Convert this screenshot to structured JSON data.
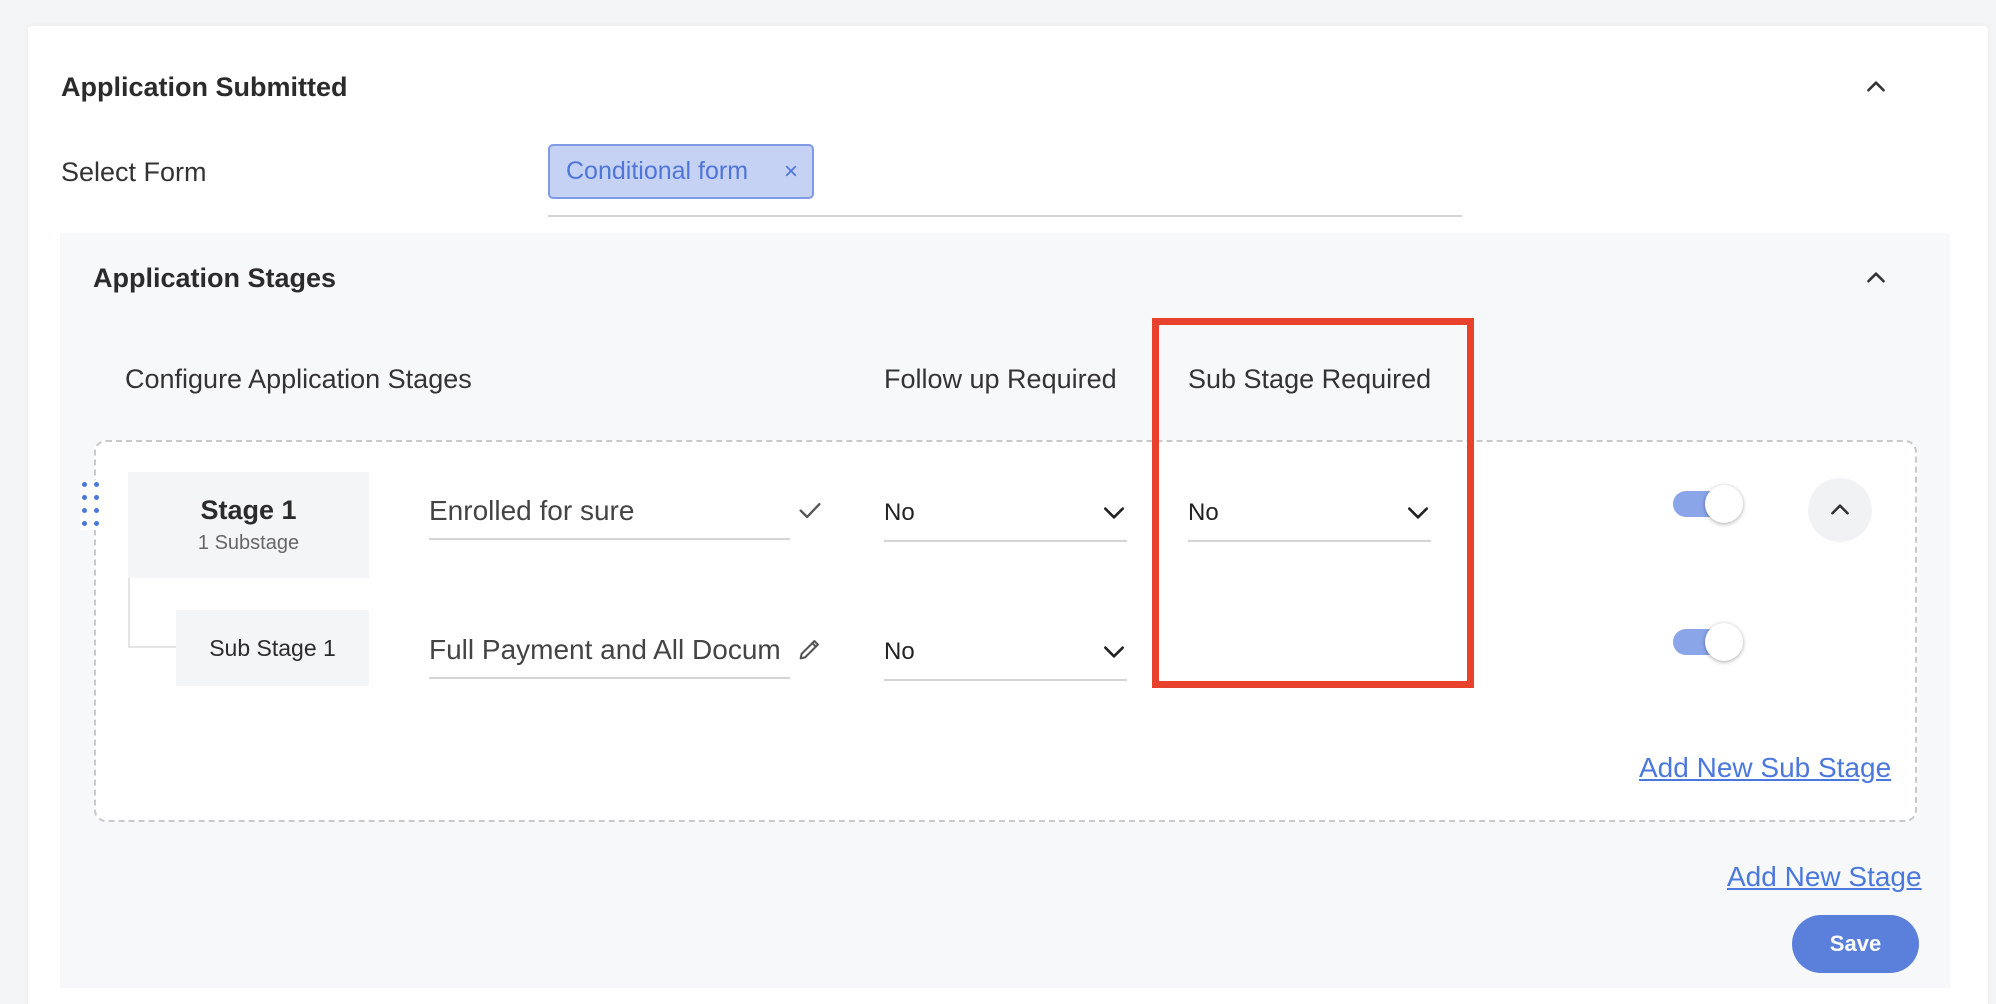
{
  "application": {
    "title": "Application Submitted"
  },
  "select_form": {
    "label": "Select Form",
    "chip_label": "Conditional form",
    "chip_remove": "×"
  },
  "stages": {
    "title": "Application Stages",
    "columns": {
      "configure": "Configure Application Stages",
      "follow_up": "Follow up Required",
      "sub_stage": "Sub Stage Required"
    },
    "stage1": {
      "name": "Stage 1",
      "substage_count": "1 Substage",
      "field_value": "Enrolled for sure",
      "follow_up": "No",
      "sub_stage_required": "No",
      "enabled": true
    },
    "substage1": {
      "name": "Sub Stage 1",
      "field_value": "Full Payment and All Docum",
      "follow_up": "No",
      "enabled": true
    },
    "add_sub_stage": "Add New Sub Stage",
    "add_stage": "Add New Stage",
    "save": "Save"
  },
  "colors": {
    "accent": "#4a78dd",
    "chip_bg": "#c5d2f4",
    "toggle_track": "#8aa5e8",
    "save_bg": "#5b80db",
    "highlight": "#e8412c"
  },
  "icons": {
    "collapse": "chevron-up-icon",
    "chip_remove": "close-icon",
    "confirm": "check-icon",
    "edit": "pencil-icon",
    "dropdown": "chevron-down-icon",
    "drag": "drag-handle-icon"
  }
}
